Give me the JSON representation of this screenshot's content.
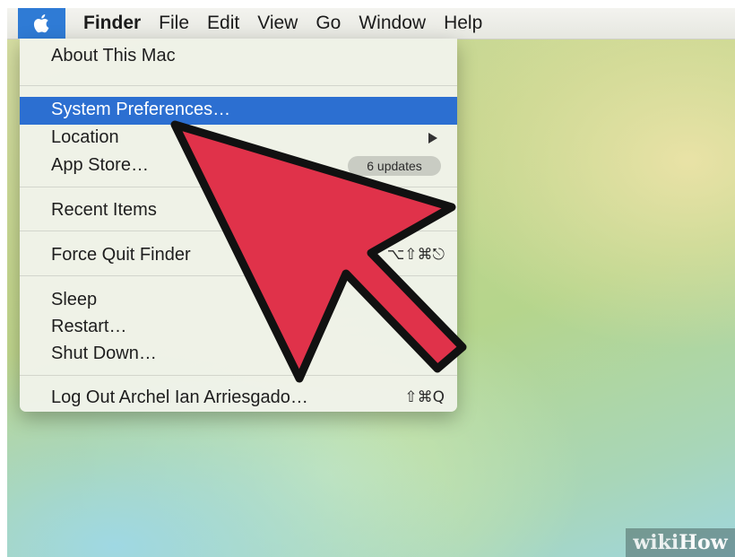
{
  "menubar": {
    "apple_icon": "apple-logo-icon",
    "items": [
      "Finder",
      "File",
      "Edit",
      "View",
      "Go",
      "Window",
      "Help"
    ]
  },
  "apple_menu": {
    "about": "About This Mac",
    "system_preferences": "System Preferences…",
    "location": "Location",
    "app_store": "App Store…",
    "app_store_badge": "6 updates",
    "recent_items": "Recent Items",
    "force_quit": "Force Quit Finder",
    "force_quit_shortcut": "⌥⇧⌘⎋",
    "sleep": "Sleep",
    "restart": "Restart…",
    "shut_down": "Shut Down…",
    "log_out": "Log Out Archel Ian Arriesgado…",
    "log_out_shortcut": "⇧⌘Q"
  },
  "colors": {
    "selection": "#2c6fd1",
    "annotation_arrow": "#e0324a"
  },
  "watermark": {
    "prefix": "wiki",
    "suffix": "How"
  }
}
